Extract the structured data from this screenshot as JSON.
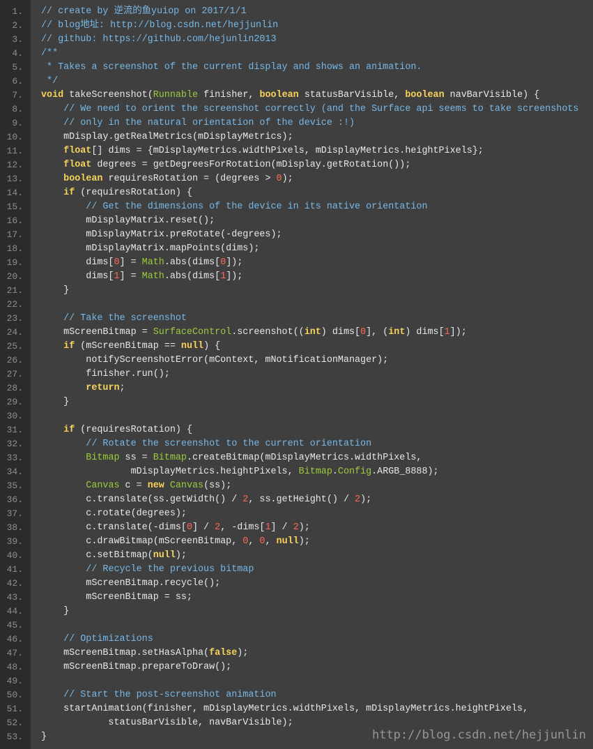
{
  "colors": {
    "background": "#3f3f3f",
    "gutter_background": "#2b2b2b",
    "line_number": "#8f8f8f",
    "plain_text": "#e8e8e8",
    "comment": "#78b8e8",
    "keyword": "#f8d35a",
    "type": "#9ccc3c",
    "number": "#ff6a55",
    "watermark": "#a6a6a6"
  },
  "code": {
    "lines": [
      {
        "num": "1.",
        "tokens": [
          [
            "cm",
            "// create by 逆流的鱼yuiop on 2017/1/1"
          ]
        ]
      },
      {
        "num": "2.",
        "tokens": [
          [
            "cm",
            "// blog地址: http://blog.csdn.net/hejjunlin"
          ]
        ]
      },
      {
        "num": "3.",
        "tokens": [
          [
            "cm",
            "// github: https://github.com/hejunlin2013"
          ]
        ]
      },
      {
        "num": "4.",
        "tokens": [
          [
            "cm",
            "/**"
          ]
        ]
      },
      {
        "num": "5.",
        "tokens": [
          [
            "cm",
            " * Takes a screenshot of the current display and shows an animation."
          ]
        ]
      },
      {
        "num": "6.",
        "tokens": [
          [
            "cm",
            " */"
          ]
        ]
      },
      {
        "num": "7.",
        "tokens": [
          [
            "kw",
            "void"
          ],
          [
            "tx",
            " takeScreenshot("
          ],
          [
            "ty",
            "Runnable"
          ],
          [
            "tx",
            " finisher, "
          ],
          [
            "kw",
            "boolean"
          ],
          [
            "tx",
            " statusBarVisible, "
          ],
          [
            "kw",
            "boolean"
          ],
          [
            "tx",
            " navBarVisible) {"
          ]
        ]
      },
      {
        "num": "8.",
        "tokens": [
          [
            "tx",
            "    "
          ],
          [
            "cm",
            "// We need to orient the screenshot correctly (and the Surface api seems to take screenshots"
          ]
        ]
      },
      {
        "num": "9.",
        "tokens": [
          [
            "tx",
            "    "
          ],
          [
            "cm",
            "// only in the natural orientation of the device :!)"
          ]
        ]
      },
      {
        "num": "10.",
        "tokens": [
          [
            "tx",
            "    mDisplay.getRealMetrics(mDisplayMetrics);"
          ]
        ]
      },
      {
        "num": "11.",
        "tokens": [
          [
            "tx",
            "    "
          ],
          [
            "kw",
            "float"
          ],
          [
            "tx",
            "[] dims = {mDisplayMetrics.widthPixels, mDisplayMetrics.heightPixels};"
          ]
        ]
      },
      {
        "num": "12.",
        "tokens": [
          [
            "tx",
            "    "
          ],
          [
            "kw",
            "float"
          ],
          [
            "tx",
            " degrees = getDegreesForRotation(mDisplay.getRotation());"
          ]
        ]
      },
      {
        "num": "13.",
        "tokens": [
          [
            "tx",
            "    "
          ],
          [
            "kw",
            "boolean"
          ],
          [
            "tx",
            " requiresRotation = (degrees > "
          ],
          [
            "num",
            "0"
          ],
          [
            "tx",
            ");"
          ]
        ]
      },
      {
        "num": "14.",
        "tokens": [
          [
            "tx",
            "    "
          ],
          [
            "kw",
            "if"
          ],
          [
            "tx",
            " (requiresRotation) {"
          ]
        ]
      },
      {
        "num": "15.",
        "tokens": [
          [
            "tx",
            "        "
          ],
          [
            "cm",
            "// Get the dimensions of the device in its native orientation"
          ]
        ]
      },
      {
        "num": "16.",
        "tokens": [
          [
            "tx",
            "        mDisplayMatrix.reset();"
          ]
        ]
      },
      {
        "num": "17.",
        "tokens": [
          [
            "tx",
            "        mDisplayMatrix.preRotate(-degrees);"
          ]
        ]
      },
      {
        "num": "18.",
        "tokens": [
          [
            "tx",
            "        mDisplayMatrix.mapPoints(dims);"
          ]
        ]
      },
      {
        "num": "19.",
        "tokens": [
          [
            "tx",
            "        dims["
          ],
          [
            "num",
            "0"
          ],
          [
            "tx",
            "] = "
          ],
          [
            "ty",
            "Math"
          ],
          [
            "tx",
            ".abs(dims["
          ],
          [
            "num",
            "0"
          ],
          [
            "tx",
            "]);"
          ]
        ]
      },
      {
        "num": "20.",
        "tokens": [
          [
            "tx",
            "        dims["
          ],
          [
            "num",
            "1"
          ],
          [
            "tx",
            "] = "
          ],
          [
            "ty",
            "Math"
          ],
          [
            "tx",
            ".abs(dims["
          ],
          [
            "num",
            "1"
          ],
          [
            "tx",
            "]);"
          ]
        ]
      },
      {
        "num": "21.",
        "tokens": [
          [
            "tx",
            "    }"
          ]
        ]
      },
      {
        "num": "22.",
        "tokens": []
      },
      {
        "num": "23.",
        "tokens": [
          [
            "tx",
            "    "
          ],
          [
            "cm",
            "// Take the screenshot"
          ]
        ]
      },
      {
        "num": "24.",
        "tokens": [
          [
            "tx",
            "    mScreenBitmap = "
          ],
          [
            "ty",
            "SurfaceControl"
          ],
          [
            "tx",
            ".screenshot(("
          ],
          [
            "kw",
            "int"
          ],
          [
            "tx",
            ") dims["
          ],
          [
            "num",
            "0"
          ],
          [
            "tx",
            "], ("
          ],
          [
            "kw",
            "int"
          ],
          [
            "tx",
            ") dims["
          ],
          [
            "num",
            "1"
          ],
          [
            "tx",
            "]);"
          ]
        ]
      },
      {
        "num": "25.",
        "tokens": [
          [
            "tx",
            "    "
          ],
          [
            "kw",
            "if"
          ],
          [
            "tx",
            " (mScreenBitmap == "
          ],
          [
            "kw",
            "null"
          ],
          [
            "tx",
            ") {"
          ]
        ]
      },
      {
        "num": "26.",
        "tokens": [
          [
            "tx",
            "        notifyScreenshotError(mContext, mNotificationManager);"
          ]
        ]
      },
      {
        "num": "27.",
        "tokens": [
          [
            "tx",
            "        finisher.run();"
          ]
        ]
      },
      {
        "num": "28.",
        "tokens": [
          [
            "tx",
            "        "
          ],
          [
            "kw",
            "return"
          ],
          [
            "tx",
            ";"
          ]
        ]
      },
      {
        "num": "29.",
        "tokens": [
          [
            "tx",
            "    }"
          ]
        ]
      },
      {
        "num": "30.",
        "tokens": []
      },
      {
        "num": "31.",
        "tokens": [
          [
            "tx",
            "    "
          ],
          [
            "kw",
            "if"
          ],
          [
            "tx",
            " (requiresRotation) {"
          ]
        ]
      },
      {
        "num": "32.",
        "tokens": [
          [
            "tx",
            "        "
          ],
          [
            "cm",
            "// Rotate the screenshot to the current orientation"
          ]
        ]
      },
      {
        "num": "33.",
        "tokens": [
          [
            "tx",
            "        "
          ],
          [
            "ty",
            "Bitmap"
          ],
          [
            "tx",
            " ss = "
          ],
          [
            "ty",
            "Bitmap"
          ],
          [
            "tx",
            ".createBitmap(mDisplayMetrics.widthPixels,"
          ]
        ]
      },
      {
        "num": "34.",
        "tokens": [
          [
            "tx",
            "                mDisplayMetrics.heightPixels, "
          ],
          [
            "ty",
            "Bitmap"
          ],
          [
            "tx",
            "."
          ],
          [
            "ty",
            "Config"
          ],
          [
            "tx",
            ".ARGB_8888);"
          ]
        ]
      },
      {
        "num": "35.",
        "tokens": [
          [
            "tx",
            "        "
          ],
          [
            "ty",
            "Canvas"
          ],
          [
            "tx",
            " c = "
          ],
          [
            "kw",
            "new"
          ],
          [
            "tx",
            " "
          ],
          [
            "ty",
            "Canvas"
          ],
          [
            "tx",
            "(ss);"
          ]
        ]
      },
      {
        "num": "36.",
        "tokens": [
          [
            "tx",
            "        c.translate(ss.getWidth() / "
          ],
          [
            "num",
            "2"
          ],
          [
            "tx",
            ", ss.getHeight() / "
          ],
          [
            "num",
            "2"
          ],
          [
            "tx",
            ");"
          ]
        ]
      },
      {
        "num": "37.",
        "tokens": [
          [
            "tx",
            "        c.rotate(degrees);"
          ]
        ]
      },
      {
        "num": "38.",
        "tokens": [
          [
            "tx",
            "        c.translate(-dims["
          ],
          [
            "num",
            "0"
          ],
          [
            "tx",
            "] / "
          ],
          [
            "num",
            "2"
          ],
          [
            "tx",
            ", -dims["
          ],
          [
            "num",
            "1"
          ],
          [
            "tx",
            "] / "
          ],
          [
            "num",
            "2"
          ],
          [
            "tx",
            ");"
          ]
        ]
      },
      {
        "num": "39.",
        "tokens": [
          [
            "tx",
            "        c.drawBitmap(mScreenBitmap, "
          ],
          [
            "num",
            "0"
          ],
          [
            "tx",
            ", "
          ],
          [
            "num",
            "0"
          ],
          [
            "tx",
            ", "
          ],
          [
            "kw",
            "null"
          ],
          [
            "tx",
            ");"
          ]
        ]
      },
      {
        "num": "40.",
        "tokens": [
          [
            "tx",
            "        c.setBitmap("
          ],
          [
            "kw",
            "null"
          ],
          [
            "tx",
            ");"
          ]
        ]
      },
      {
        "num": "41.",
        "tokens": [
          [
            "tx",
            "        "
          ],
          [
            "cm",
            "// Recycle the previous bitmap"
          ]
        ]
      },
      {
        "num": "42.",
        "tokens": [
          [
            "tx",
            "        mScreenBitmap.recycle();"
          ]
        ]
      },
      {
        "num": "43.",
        "tokens": [
          [
            "tx",
            "        mScreenBitmap = ss;"
          ]
        ]
      },
      {
        "num": "44.",
        "tokens": [
          [
            "tx",
            "    }"
          ]
        ]
      },
      {
        "num": "45.",
        "tokens": []
      },
      {
        "num": "46.",
        "tokens": [
          [
            "tx",
            "    "
          ],
          [
            "cm",
            "// Optimizations"
          ]
        ]
      },
      {
        "num": "47.",
        "tokens": [
          [
            "tx",
            "    mScreenBitmap.setHasAlpha("
          ],
          [
            "kw",
            "false"
          ],
          [
            "tx",
            ");"
          ]
        ]
      },
      {
        "num": "48.",
        "tokens": [
          [
            "tx",
            "    mScreenBitmap.prepareToDraw();"
          ]
        ]
      },
      {
        "num": "49.",
        "tokens": []
      },
      {
        "num": "50.",
        "tokens": [
          [
            "tx",
            "    "
          ],
          [
            "cm",
            "// Start the post-screenshot animation"
          ]
        ]
      },
      {
        "num": "51.",
        "tokens": [
          [
            "tx",
            "    startAnimation(finisher, mDisplayMetrics.widthPixels, mDisplayMetrics.heightPixels,"
          ]
        ]
      },
      {
        "num": "52.",
        "tokens": [
          [
            "tx",
            "            statusBarVisible, navBarVisible);"
          ]
        ]
      },
      {
        "num": "53.",
        "tokens": [
          [
            "tx",
            "}"
          ]
        ]
      }
    ]
  },
  "watermark": "http://blog.csdn.net/hejjunlin"
}
